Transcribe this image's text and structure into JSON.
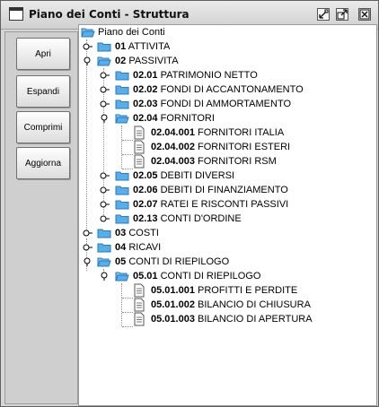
{
  "window": {
    "title": "Piano dei Conti - Struttura",
    "icons": [
      "window-icon",
      "iconify-icon",
      "maximize-icon",
      "close-icon"
    ]
  },
  "buttons": {
    "open": "Apri",
    "expand": "Espandi",
    "collapse": "Comprimi",
    "refresh": "Aggiorna"
  },
  "tree": {
    "root": "Piano dei Conti",
    "n01": {
      "code": "01",
      "name": "ATTIVITA"
    },
    "n02": {
      "code": "02",
      "name": "PASSIVITA"
    },
    "n0201": {
      "code": "02.01",
      "name": "PATRIMONIO NETTO"
    },
    "n0202": {
      "code": "02.02",
      "name": "FONDI DI ACCANTONAMENTO"
    },
    "n0203": {
      "code": "02.03",
      "name": "FONDI DI AMMORTAMENTO"
    },
    "n0204": {
      "code": "02.04",
      "name": "FORNITORI"
    },
    "n0204001": {
      "code": "02.04.001",
      "name": "FORNITORI ITALIA"
    },
    "n0204002": {
      "code": "02.04.002",
      "name": "FORNITORI ESTERI"
    },
    "n0204003": {
      "code": "02.04.003",
      "name": "FORNITORI RSM"
    },
    "n0205": {
      "code": "02.05",
      "name": "DEBITI DIVERSI"
    },
    "n0206": {
      "code": "02.06",
      "name": "DEBITI DI FINANZIAMENTO"
    },
    "n0207": {
      "code": "02.07",
      "name": "RATEI E RISCONTI PASSIVI"
    },
    "n0213": {
      "code": "02.13",
      "name": "CONTI D'ORDINE"
    },
    "n03": {
      "code": "03",
      "name": "COSTI"
    },
    "n04": {
      "code": "04",
      "name": "RICAVI"
    },
    "n05": {
      "code": "05",
      "name": "CONTI DI RIEPILOGO"
    },
    "n0501": {
      "code": "05.01",
      "name": "CONTI DI RIEPILOGO"
    },
    "n0501001": {
      "code": "05.01.001",
      "name": "PROFITTI E PERDITE"
    },
    "n0501002": {
      "code": "05.01.002",
      "name": "BILANCIO DI CHIUSURA"
    },
    "n0501003": {
      "code": "05.01.003",
      "name": "BILANCIO DI APERTURA"
    }
  },
  "colors": {
    "folder": "#5aaee8",
    "folder_dark": "#2a78b8",
    "tree_background": "#ffffff",
    "window_background": "#d6d6d6"
  }
}
